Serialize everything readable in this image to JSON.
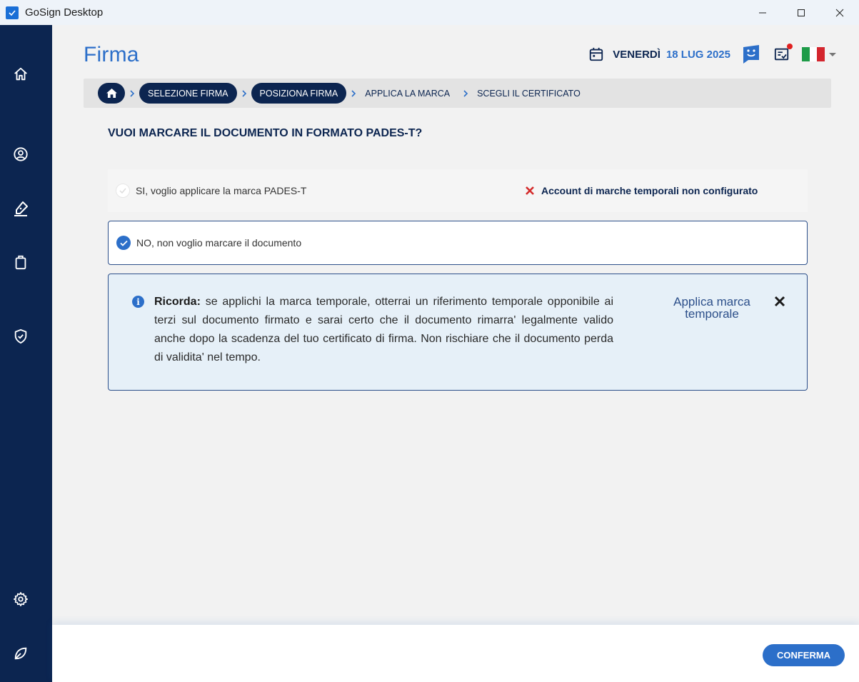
{
  "window": {
    "title": "GoSign Desktop"
  },
  "header": {
    "title": "Firma",
    "day": "VENERDÌ",
    "date": "18 LUG 2025"
  },
  "breadcrumb": {
    "steps": [
      "SELEZIONE FIRMA",
      "POSIZIONA FIRMA",
      "APPLICA LA MARCA",
      "SCEGLI IL CERTIFICATO"
    ]
  },
  "question": "VUOI MARCARE IL DOCUMENTO IN FORMATO PADES-T?",
  "options": {
    "yes": {
      "label": "SI, voglio applicare la marca PADES-T",
      "selected": false,
      "warning": "Account di marche temporali non configurato"
    },
    "no": {
      "label": "NO, non voglio marcare il documento",
      "selected": true
    }
  },
  "info": {
    "heading": "Ricorda:",
    "text": " se applichi la marca temporale, otterrai un riferimento temporale opponibile ai terzi sul documento firmato e sarai certo che il documento rimarra' legalmente valido anche dopo la scadenza del tuo certificato di firma. Non rischiare che il documento perda di validita' nel tempo.",
    "link": "Applica marca temporale"
  },
  "footer": {
    "confirm_label": "CONFERMA"
  },
  "colors": {
    "navy": "#0c2550",
    "accent": "#2c6fc9",
    "error": "#d42b2b",
    "flag_green": "#1e9b48",
    "flag_white": "#ffffff",
    "flag_red": "#d4262e",
    "notification": "#e02020"
  },
  "icons": {
    "sidebar": [
      "home-icon",
      "user-icon",
      "sign-pen-icon",
      "clipboard-icon",
      "shield-check-icon",
      "gear-icon",
      "leaf-icon"
    ],
    "header": [
      "calendar-icon",
      "chat-bot-icon",
      "checklist-icon",
      "italy-flag-icon"
    ]
  }
}
